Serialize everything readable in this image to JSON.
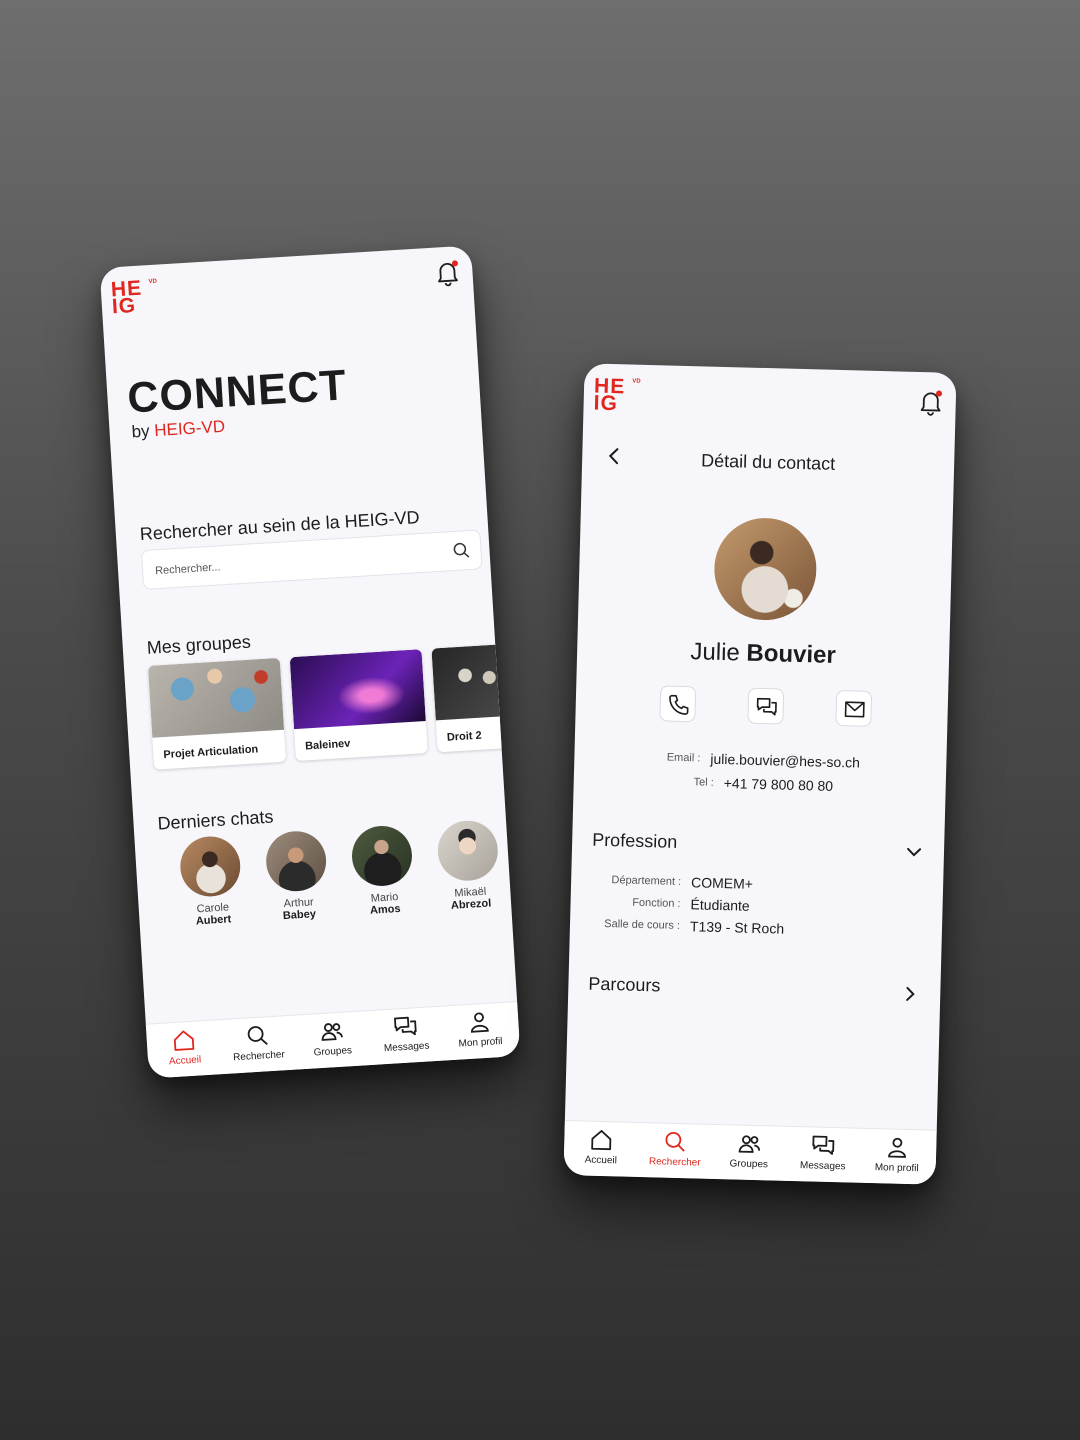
{
  "brand": {
    "logo_line1": "HE",
    "logo_line2": "IG",
    "logo_sup": "VD",
    "color": "#e0271f"
  },
  "home": {
    "title": "CONNECT",
    "by_prefix": "by",
    "by_brand": "HEIG-VD",
    "search": {
      "title": "Rechercher au sein de la HEIG-VD",
      "placeholder": "Rechercher..."
    },
    "groups": {
      "title": "Mes groupes",
      "items": [
        {
          "label": "Projet Articulation"
        },
        {
          "label": "Baleinev"
        },
        {
          "label": "Droit 2"
        }
      ]
    },
    "chats": {
      "title": "Derniers chats",
      "items": [
        {
          "first": "Carole",
          "last": "Aubert"
        },
        {
          "first": "Arthur",
          "last": "Babey"
        },
        {
          "first": "Mario",
          "last": "Amos"
        },
        {
          "first": "Mikaël",
          "last": "Abrezol"
        }
      ]
    }
  },
  "tabs": [
    {
      "label": "Accueil",
      "icon": "home-icon"
    },
    {
      "label": "Rechercher",
      "icon": "search-icon"
    },
    {
      "label": "Groupes",
      "icon": "users-icon"
    },
    {
      "label": "Messages",
      "icon": "chat-icon"
    },
    {
      "label": "Mon profil",
      "icon": "user-icon"
    }
  ],
  "detail": {
    "title": "Détail du contact",
    "first_name": "Julie",
    "last_name": "Bouvier",
    "email_label": "Email :",
    "email": "julie.bouvier@hes-so.ch",
    "tel_label": "Tel :",
    "tel": "+41 79 800 80 80",
    "profession": {
      "title": "Profession",
      "rows": [
        {
          "k": "Département :",
          "v": "COMEM+"
        },
        {
          "k": "Fonction :",
          "v": "Étudiante"
        },
        {
          "k": "Salle de cours :",
          "v": "T139 - St Roch"
        }
      ]
    },
    "parcours_title": "Parcours"
  }
}
